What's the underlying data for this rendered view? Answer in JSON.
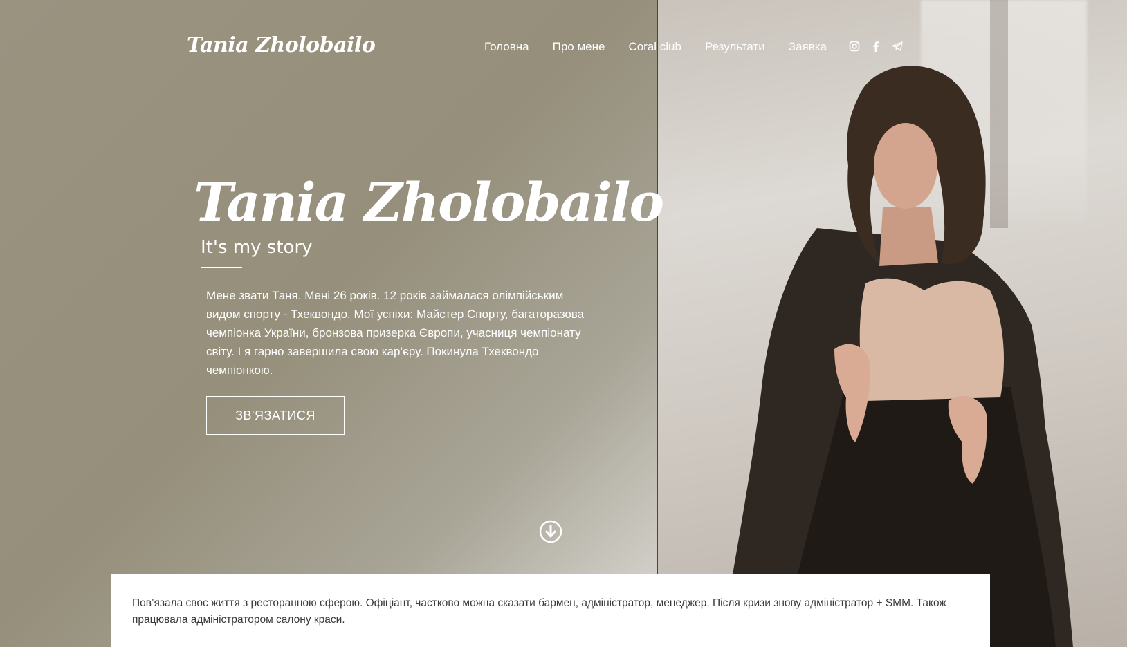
{
  "header": {
    "brand": "Tania Zholobailo",
    "nav": [
      {
        "label": "Головна"
      },
      {
        "label": "Про мене"
      },
      {
        "label": "Coral club"
      },
      {
        "label": "Результати"
      },
      {
        "label": "Заявка"
      }
    ],
    "socials": [
      "instagram-icon",
      "facebook-icon",
      "telegram-icon"
    ]
  },
  "hero": {
    "title": "Tania Zholobailo",
    "subtitle": "It's my story",
    "bio": "Мене звати Таня. Мені 26 років. 12 років займалася олімпійським видом спорту - Тхеквондо. Мої успіхи: Майстер Спорту, багаторазова чемпіонка України, бронзова призерка Європи, учасниця чемпіонату світу. І я гарно завершила свою кар’єру. Покинула Тхеквондо чемпіонкою.",
    "cta_label": "ЗВ'ЯЗАТИСЯ",
    "scroll_icon": "arrow-down-circle-icon"
  },
  "info": {
    "text": "Пов’язала своє життя з ресторанною сферою. Офіціант, частково можна сказати бармен, адміністратор, менеджер. Після кризи знову адміністратор + SMM. Також працювала адміністратором салону краси."
  },
  "colors": {
    "hero_bg": "#9a9380",
    "text": "#ffffff",
    "card_bg": "#ffffff",
    "card_text": "#3a3a3a"
  }
}
